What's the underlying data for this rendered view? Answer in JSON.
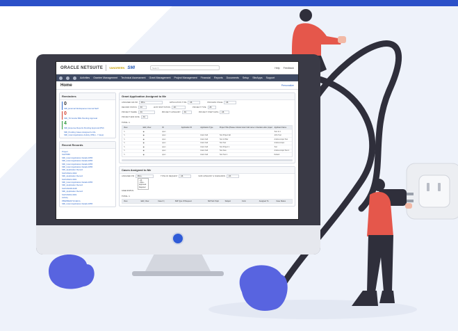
{
  "app": {
    "brand": "ORACLE NETSUITE",
    "partner": "VANDREEN",
    "logo": "SMI",
    "search_placeholder": "Search",
    "header_links": [
      "Help",
      "Feedback"
    ]
  },
  "nav": {
    "items": [
      "Activities",
      "Grantee Management",
      "Technical Assessment",
      "Grant Management",
      "Project Management",
      "Financial",
      "Reports",
      "Documents",
      "Setup",
      "SiteApps",
      "Support"
    ]
  },
  "page": {
    "title": "Home",
    "personalize": "Personalize"
  },
  "reminders": {
    "title": "Reminders",
    "items": [
      {
        "count": "0",
        "label": "SMI_External Workspaces Internal Staff"
      },
      {
        "count": "0",
        "label": "SMI_TA Vendor Bills Pending Approval"
      },
      {
        "count": "4",
        "label": "SMI_Expense Reports Pending Approval (PM)"
      }
    ],
    "small": [
      "SMI_Pending Cases Assigned to Me",
      "SMI_Grant Application Activity (PMs) - 7 days)"
    ]
  },
  "recent": {
    "title": "Recent Records",
    "items": [
      "Project",
      "SAP7865",
      "SMI_Grant Application Details #255",
      "SMI_Grant Application Details #255",
      "SMI_Grant Application Details #255",
      "SMI_Grant Application Details #255",
      "SMI_Application Record",
      "SAP-06321-0302",
      "SMI_Application Record",
      "SAP-06321-0301",
      "SMI_Grant Application Details #255",
      "SMI_Application Record",
      "SAP-06238-0248",
      "SMI_Application Record",
      "SAP-06261-0301",
      "Activity",
      "PBW08020713 EM-A",
      "SMI_Grant Application Details #255"
    ]
  },
  "grant_apps": {
    "title": "Grant Application Assigned to Me",
    "filters": [
      {
        "label": "ASSIGNED GM PM",
        "value": "-Mine-"
      },
      {
        "label": "APPLICATION TYPE",
        "value": "-All-"
      },
      {
        "label": "PROCESS STAGE",
        "value": "-All-"
      },
      {
        "label": "RECORD STATUS",
        "value": "-All-"
      },
      {
        "label": "HOST INSTITUTION",
        "value": "-All-"
      },
      {
        "label": "PROJECT TYPE",
        "value": "-All-"
      },
      {
        "label": "PROJECT THEME",
        "value": "-All-"
      },
      {
        "label": "PROJECT CATEGORY",
        "value": "-All-"
      },
      {
        "label": "PROJECT START DATE",
        "value": "-All-"
      },
      {
        "label": "PROJECT END DATE",
        "value": "-All-"
      }
    ],
    "total": "TOTAL: 1",
    "columns": [
      "View",
      "Edit | View",
      "ID",
      "Application ID",
      "Application Type",
      "Project Title (Please Include Grant Call name in brackets after project title, if any)",
      "Applicant Name"
    ],
    "rows": [
      [
        "",
        "",
        "open",
        "",
        "",
        "",
        "Test 11 1"
      ],
      [
        "",
        "",
        "open",
        "",
        "Grant Call",
        "Test Project Ed",
        "John Test"
      ],
      [
        "",
        "",
        "open",
        "",
        "Grant Call",
        "Test 12 Mar",
        "Andrew Acqui Test"
      ],
      [
        "",
        "",
        "open",
        "",
        "Grant Call",
        "Test Test",
        "Andrew Acqui"
      ],
      [
        "",
        "",
        "open",
        "",
        "Grant Call",
        "Test Project 1",
        "Test"
      ],
      [
        "",
        "",
        "open",
        "",
        "Grant Call",
        "Test New",
        "Andrew Acqui Test 2"
      ],
      [
        "",
        "",
        "open",
        "",
        "Grant Call",
        "Test Test 4",
        "Default"
      ]
    ]
  },
  "cases": {
    "title": "Cases Assigned to Me",
    "filters": [
      {
        "label": "ASSIGNED PM",
        "value": "-Mine-"
      },
      {
        "label": "TYPE OF REQUEST",
        "value": "-All-"
      },
      {
        "label": "SUB CATEGORY & SCENARIOS",
        "value": "-All-"
      }
    ],
    "dropdown": [
      "- All -",
      "- Mine -",
      "Approved",
      "Rejected"
    ],
    "status_label": "CASE STATUS",
    "total": "TOTAL: 1",
    "columns": [
      "View",
      "Edit | View",
      "Case # |",
      "SMI Type Of Request",
      "SMI Sub Topic",
      "Subject",
      "Form",
      "Assigned To",
      "Case Status"
    ]
  },
  "colors": {
    "brand_blue": "#2b50c8",
    "monitor": "#3a3a46",
    "figure_red": "#e5574b",
    "figure_dark": "#2f2f3b",
    "blob_blue": "#5864e0",
    "reminder_blue": "#2c66c9",
    "reminder_red": "#d43b2a",
    "reminder_green": "#2f9a3d"
  }
}
